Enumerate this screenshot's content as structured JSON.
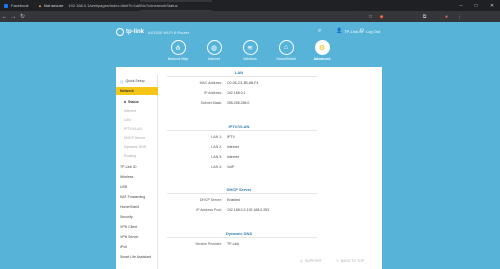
{
  "browser": {
    "tabs": [
      {
        "label": "Facebook",
        "favicon_color": "#1877f2",
        "active": false
      },
      {
        "label": "Networks and Broadband - Learn",
        "favicon_color": "#d93025",
        "active": false
      },
      {
        "label": "AX1500 Wi-Fi 6 Router",
        "favicon_color": "#57b4d8",
        "active": true
      }
    ],
    "new_tab": "+",
    "window_controls": [
      "–",
      "□",
      "✕"
    ],
    "nav": {
      "back": "←",
      "forward": "→",
      "reload": "↻"
    },
    "security_label": "Not secure",
    "url": "192.168.0.1/webpages/index.html?t=1a8f4c7c#networkStatus"
  },
  "router": {
    "brand": "tp-link",
    "model": "AX1500 Wi-Fi 6 Router",
    "tp_link_id": "TP-Link ID",
    "logout": "Log Out",
    "nav": [
      {
        "label": "Network Map",
        "icon": "network-map-icon",
        "active": false
      },
      {
        "label": "Internet",
        "icon": "globe-icon",
        "active": false
      },
      {
        "label": "Wireless",
        "icon": "wireless-icon",
        "active": false
      },
      {
        "label": "HomeShield",
        "icon": "shield-icon",
        "active": false
      },
      {
        "label": "Advanced",
        "icon": "gear-icon",
        "active": true
      }
    ]
  },
  "sidebar": {
    "quick_setup": "Quick Setup",
    "items": [
      {
        "label": "Network",
        "type": "highlight"
      },
      {
        "label": "Status",
        "type": "sub-on"
      },
      {
        "label": "Internet",
        "type": "sub"
      },
      {
        "label": "LAN",
        "type": "sub"
      },
      {
        "label": "IPTV/VLAN",
        "type": "sub"
      },
      {
        "label": "DHCP Server",
        "type": "sub"
      },
      {
        "label": "Dynamic DNS",
        "type": "sub"
      },
      {
        "label": "Routing",
        "type": "sub"
      },
      {
        "label": "TP-Link ID",
        "type": "item"
      },
      {
        "label": "Wireless",
        "type": "item"
      },
      {
        "label": "USB",
        "type": "item"
      },
      {
        "label": "NAT Forwarding",
        "type": "item"
      },
      {
        "label": "HomeShield",
        "type": "item"
      },
      {
        "label": "Security",
        "type": "item"
      },
      {
        "label": "VPN Client",
        "type": "item"
      },
      {
        "label": "VPN Server",
        "type": "item"
      },
      {
        "label": "IPv6",
        "type": "item"
      },
      {
        "label": "Smart Life Assistant",
        "type": "item"
      }
    ]
  },
  "content": {
    "lan": {
      "title": "LAN",
      "rows": [
        {
          "key": "MAC Address:",
          "value": "C0-06-C3-3B-A8-F4"
        },
        {
          "key": "IP Address:",
          "value": "192.168.0.1"
        },
        {
          "key": "Subnet Mask:",
          "value": "255.255.255.0"
        }
      ]
    },
    "iptv": {
      "title": "IPTV/VLAN",
      "rows": [
        {
          "key": "LAN 1:",
          "value": "IPTV"
        },
        {
          "key": "LAN 2:",
          "value": "Internet"
        },
        {
          "key": "LAN 3:",
          "value": "Internet"
        },
        {
          "key": "LAN 4:",
          "value": "VoIP"
        }
      ]
    },
    "dhcp": {
      "title": "DHCP Server",
      "rows": [
        {
          "key": "DHCP Server:",
          "value": "Enabled"
        },
        {
          "key": "IP Address Pool:",
          "value": "192.168.0.2-192.168.0.253"
        }
      ]
    },
    "ddns": {
      "title": "Dynamic DNS",
      "rows": [
        {
          "key": "Service Provider:",
          "value": "TP-Link"
        }
      ]
    }
  },
  "footer": {
    "support": "SUPPORT",
    "back_to_top": "BACK TO TOP"
  }
}
